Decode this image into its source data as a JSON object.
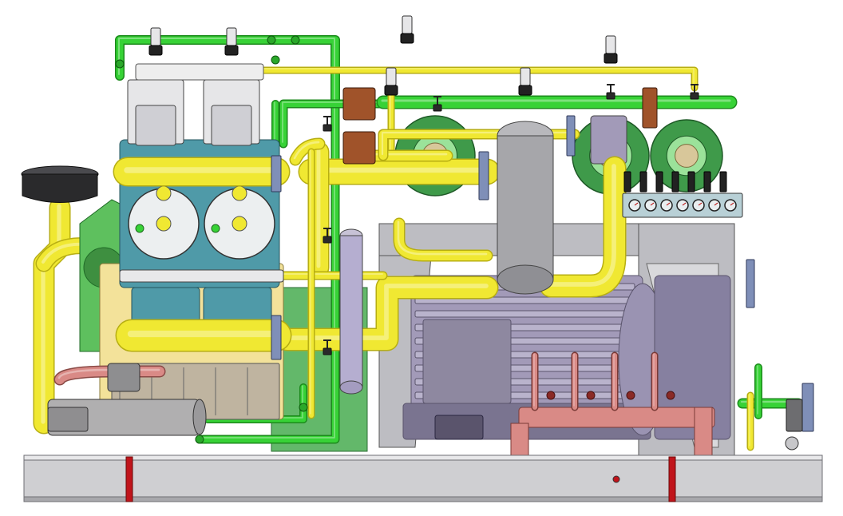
{
  "scene": {
    "subject": "cad-render-compressor-skid",
    "labels": []
  },
  "palette": {
    "background": "#ffffff",
    "skid_base": "#cfcfd2",
    "skid_outline": "#6f6f74",
    "red_marker": "#c0141b",
    "frame_steel": "#bdbdc2",
    "frame_dark": "#8e8e94",
    "pipe_yellow": "#f0e832",
    "pipe_yellow_shade": "#b7ae12",
    "pipe_green": "#37d236",
    "pipe_green_shade": "#1c8a1c",
    "dark_green": "#3f9a4a",
    "light_green": "#9be29a",
    "motor_purple": "#a29ab8",
    "motor_dark": "#5a546c",
    "vessel_grey": "#a6a6aa",
    "cylinder_teal": "#4f9aa8",
    "head_white": "#eceff0",
    "crankcase_yellow": "#f3e29a",
    "manifold_red": "#d98a86",
    "flange_blue": "#7f8fb8",
    "valve_brown": "#a0532a",
    "gauge_panel": "#b8d0d6",
    "tank_black": "#2a2a2c",
    "gearbox_green": "#5ec05e"
  },
  "icons": [
    "pressure-gauge-icon",
    "valve-icon",
    "flange-icon",
    "red-marker-icon"
  ]
}
